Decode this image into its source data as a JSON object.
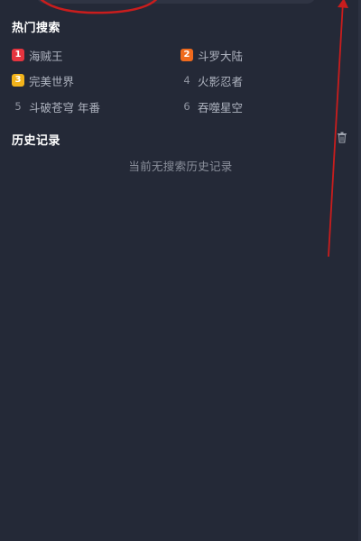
{
  "hot_search": {
    "title": "热门搜索",
    "items": [
      {
        "rank": "1",
        "label": "海贼王",
        "badge_color": "#e5343f"
      },
      {
        "rank": "2",
        "label": "斗罗大陆",
        "badge_color": "#f06a1d"
      },
      {
        "rank": "3",
        "label": "完美世界",
        "badge_color": "#f2b31b"
      },
      {
        "rank": "4",
        "label": "火影忍者",
        "badge_color": ""
      },
      {
        "rank": "5",
        "label": "斗破苍穹 年番",
        "badge_color": ""
      },
      {
        "rank": "6",
        "label": "吞噬星空",
        "badge_color": ""
      }
    ]
  },
  "history": {
    "title": "历史记录",
    "empty_text": "当前无搜索历史记录",
    "clear_icon": "trash-icon"
  },
  "colors": {
    "background": "#242937",
    "annotation": "#c91d1d"
  }
}
